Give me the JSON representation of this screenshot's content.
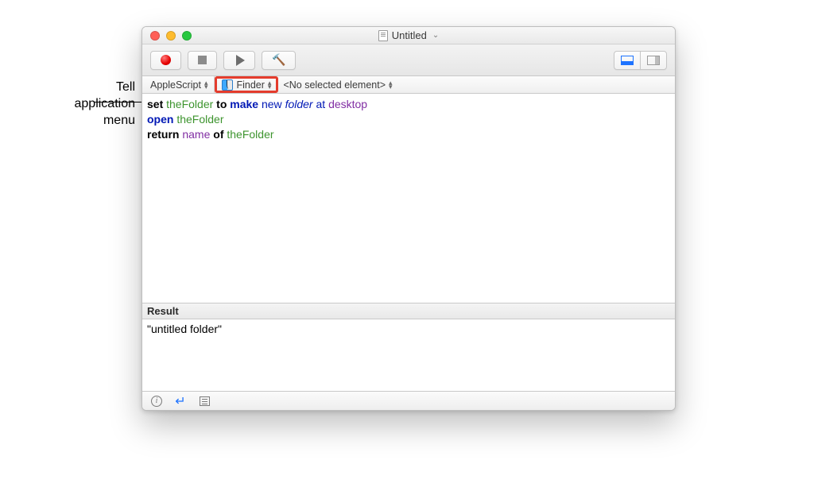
{
  "annotation": {
    "line1": "Tell",
    "line2": "application",
    "line3": "menu"
  },
  "window": {
    "title": "Untitled"
  },
  "navbar": {
    "lang": "AppleScript",
    "app": "Finder",
    "element": "<No selected element>"
  },
  "code": {
    "l1": {
      "t1": "set",
      "t2": "theFolder",
      "t3": "to",
      "t4": "make",
      "t5": "new",
      "t6": "folder",
      "t7": "at",
      "t8": "desktop"
    },
    "l2": {
      "t1": "open",
      "t2": "theFolder"
    },
    "l3": {
      "t1": "return",
      "t2": "name",
      "t3": "of",
      "t4": "theFolder"
    }
  },
  "result": {
    "label": "Result",
    "value": "\"untitled folder\""
  }
}
